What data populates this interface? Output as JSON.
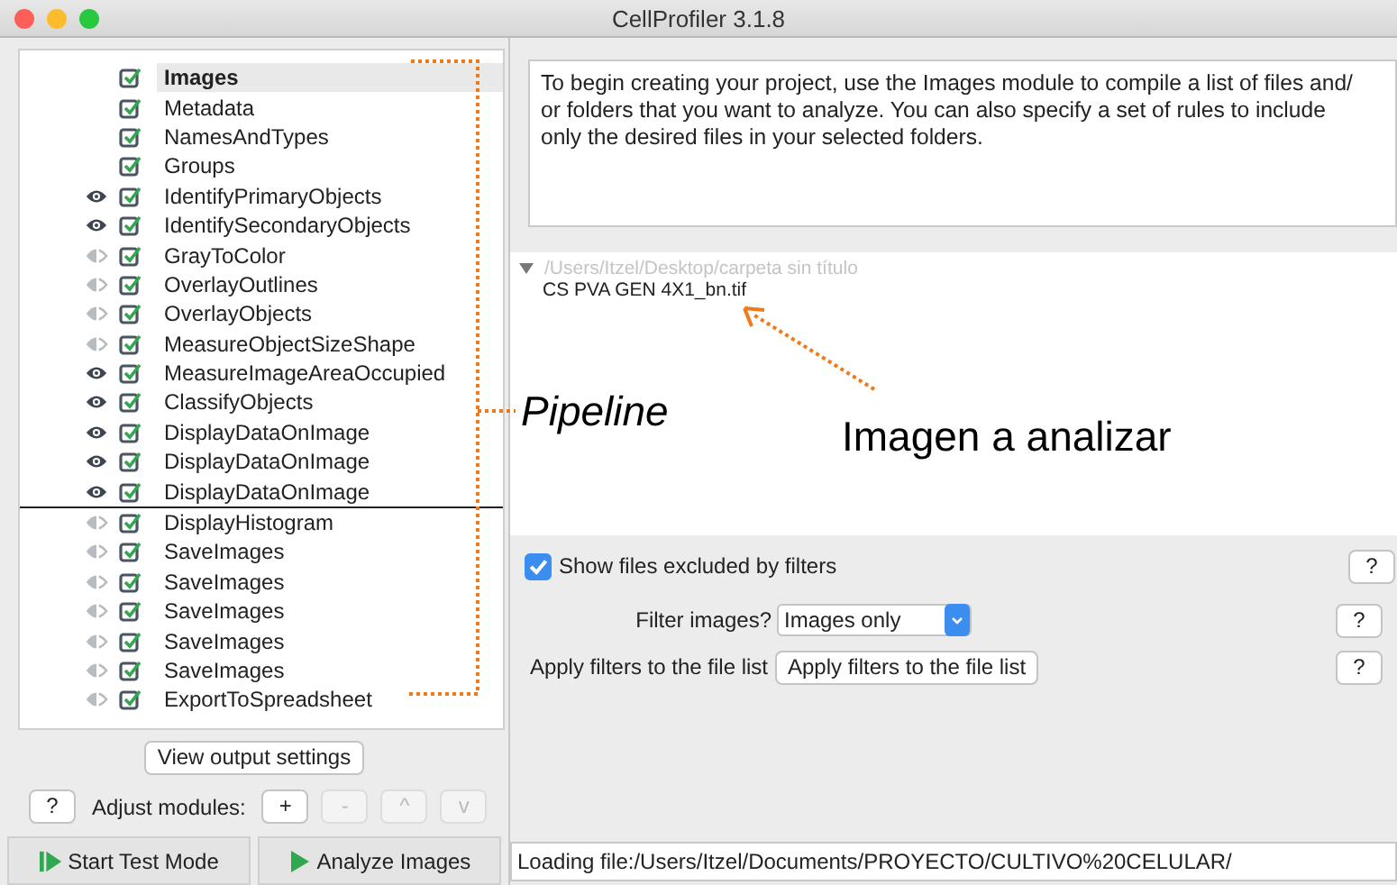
{
  "window": {
    "title": "CellProfiler 3.1.8"
  },
  "pipeline": {
    "modules": [
      {
        "name": "Images",
        "kind": "input",
        "enabled": true,
        "selected": true
      },
      {
        "name": "Metadata",
        "kind": "input",
        "enabled": true,
        "selected": false
      },
      {
        "name": "NamesAndTypes",
        "kind": "input",
        "enabled": true,
        "selected": false
      },
      {
        "name": "Groups",
        "kind": "input",
        "enabled": true,
        "selected": false
      },
      {
        "name": "IdentifyPrimaryObjects",
        "kind": "module",
        "visible": true,
        "enabled": true,
        "selected": false
      },
      {
        "name": "IdentifySecondaryObjects",
        "kind": "module",
        "visible": true,
        "enabled": true,
        "selected": false
      },
      {
        "name": "GrayToColor",
        "kind": "module",
        "visible": false,
        "enabled": true,
        "selected": false
      },
      {
        "name": "OverlayOutlines",
        "kind": "module",
        "visible": false,
        "enabled": true,
        "selected": false
      },
      {
        "name": "OverlayObjects",
        "kind": "module",
        "visible": false,
        "enabled": true,
        "selected": false
      },
      {
        "name": "MeasureObjectSizeShape",
        "kind": "module",
        "visible": false,
        "enabled": true,
        "selected": false
      },
      {
        "name": "MeasureImageAreaOccupied",
        "kind": "module",
        "visible": true,
        "enabled": true,
        "selected": false
      },
      {
        "name": "ClassifyObjects",
        "kind": "module",
        "visible": true,
        "enabled": true,
        "selected": false
      },
      {
        "name": "DisplayDataOnImage",
        "kind": "module",
        "visible": true,
        "enabled": true,
        "selected": false
      },
      {
        "name": "DisplayDataOnImage",
        "kind": "module",
        "visible": true,
        "enabled": true,
        "selected": false
      },
      {
        "name": "DisplayDataOnImage",
        "kind": "module",
        "visible": true,
        "enabled": true,
        "selected": false,
        "line_below": true
      },
      {
        "name": "DisplayHistogram",
        "kind": "module",
        "visible": false,
        "enabled": true,
        "selected": false
      },
      {
        "name": "SaveImages",
        "kind": "module",
        "visible": false,
        "enabled": true,
        "selected": false
      },
      {
        "name": "SaveImages",
        "kind": "module",
        "visible": false,
        "enabled": true,
        "selected": false
      },
      {
        "name": "SaveImages",
        "kind": "module",
        "visible": false,
        "enabled": true,
        "selected": false
      },
      {
        "name": "SaveImages",
        "kind": "module",
        "visible": false,
        "enabled": true,
        "selected": false
      },
      {
        "name": "SaveImages",
        "kind": "module",
        "visible": false,
        "enabled": true,
        "selected": false
      },
      {
        "name": "ExportToSpreadsheet",
        "kind": "module",
        "visible": false,
        "enabled": true,
        "selected": false
      }
    ]
  },
  "pipeline_controls": {
    "view_output": "View output settings",
    "help": "?",
    "adjust_label": "Adjust modules:",
    "adjust": [
      {
        "label": "+",
        "disabled": false
      },
      {
        "label": "-",
        "disabled": true
      },
      {
        "label": "^",
        "disabled": true
      },
      {
        "label": "v",
        "disabled": true
      }
    ],
    "start_test": "Start Test Mode",
    "analyze": "Analyze Images"
  },
  "help_text": "To begin creating your project, use the Images module to compile a list of files and/ or folders that you want to analyze. You can also specify a set of rules to include only the desired files in your selected folders.",
  "file_tree": {
    "folder": "/Users/Itzel/Desktop/carpeta sin título",
    "expanded": true,
    "files": [
      "CS PVA GEN 4X1_bn.tif"
    ]
  },
  "filters": {
    "show_excluded": {
      "label": "Show files excluded by filters",
      "checked": true,
      "help": "?"
    },
    "filter_images": {
      "label": "Filter images?",
      "value": "Images only",
      "help": "?"
    },
    "apply": {
      "label": "Apply filters to the file list",
      "button": "Apply filters to the file list",
      "help": "?"
    }
  },
  "status_bar": "Loading file:/Users/Itzel/Documents/PROYECTO/CULTIVO%20CELULAR/",
  "annotations": {
    "pipeline": "Pipeline",
    "image": "Imagen a analizar"
  }
}
